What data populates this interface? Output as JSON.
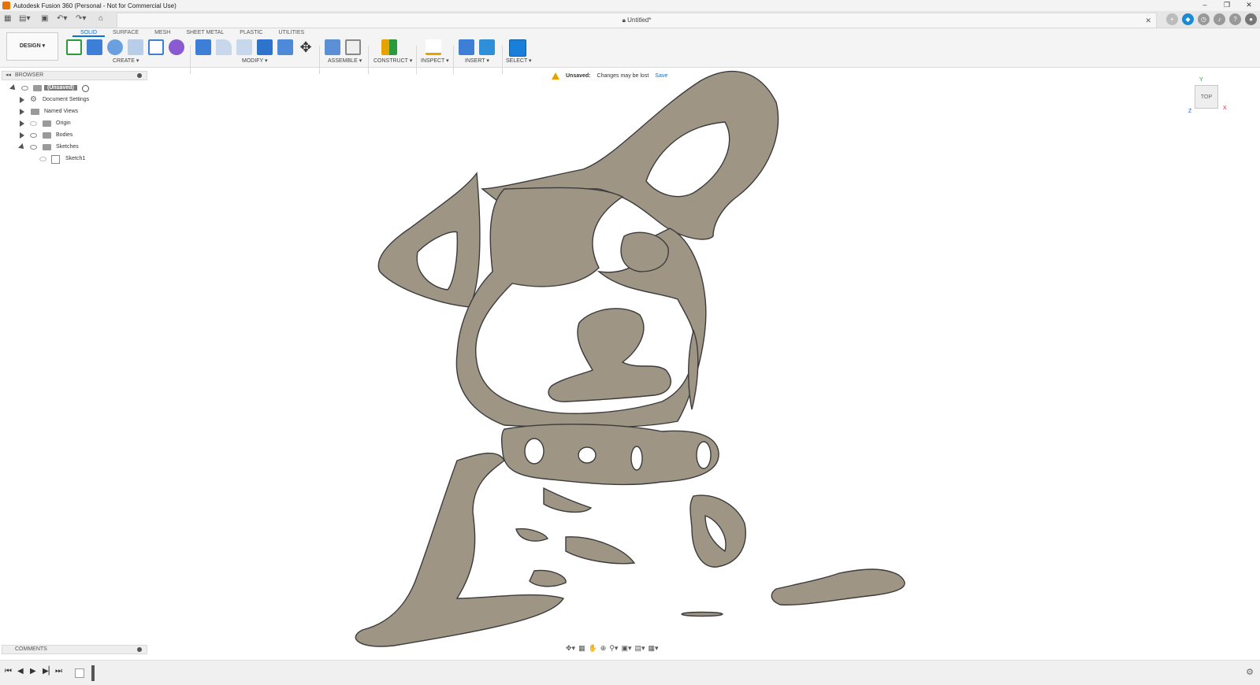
{
  "window": {
    "title": "Autodesk Fusion 360 (Personal - Not for Commercial Use)"
  },
  "document": {
    "tab_title": "Untitled*"
  },
  "workspace": {
    "label": "DESIGN"
  },
  "ribbon": {
    "tabs": [
      "SOLID",
      "SURFACE",
      "MESH",
      "SHEET METAL",
      "PLASTIC",
      "UTILITIES"
    ],
    "active_tab": "SOLID",
    "groups": [
      "CREATE",
      "MODIFY",
      "ASSEMBLE",
      "CONSTRUCT",
      "INSPECT",
      "INSERT",
      "SELECT"
    ]
  },
  "browser": {
    "header": "BROWSER",
    "root": "(Unsaved)",
    "items": [
      {
        "label": "Document Settings",
        "icon": "gear-icon"
      },
      {
        "label": "Named Views",
        "icon": "folder-icon"
      },
      {
        "label": "Origin",
        "icon": "folder-icon"
      },
      {
        "label": "Bodies",
        "icon": "folder-icon"
      },
      {
        "label": "Sketches",
        "icon": "folder-icon"
      },
      {
        "label": "Sketch1",
        "icon": "sketch-icon"
      }
    ]
  },
  "notice": {
    "status": "Unsaved:",
    "message": "Changes may be lost",
    "action": "Save"
  },
  "viewcube": {
    "face": "TOP",
    "axes": [
      "Y",
      "X",
      "Z"
    ]
  },
  "comments": {
    "label": "COMMENTS"
  },
  "colors": {
    "accent": "#0a6fd6",
    "sketch_fill": "#9e9585",
    "warning": "#e8a200"
  }
}
